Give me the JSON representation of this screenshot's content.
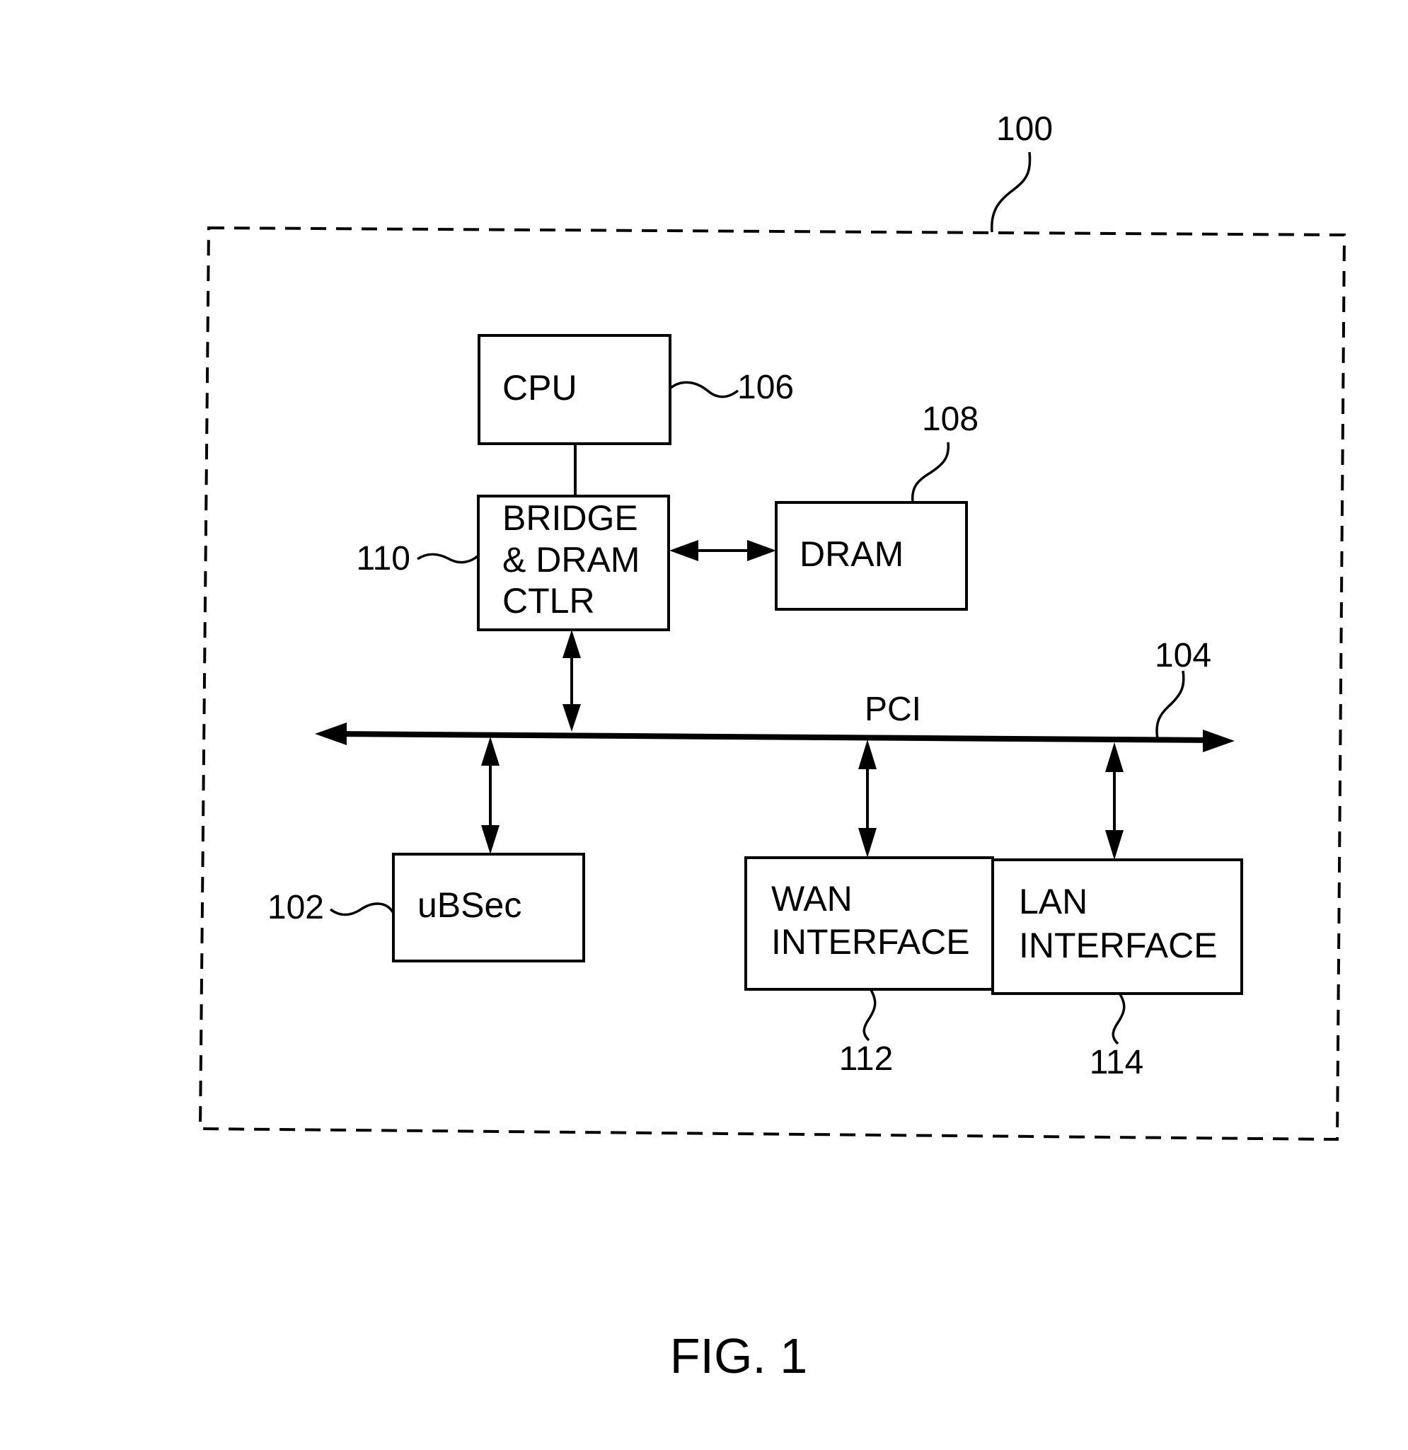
{
  "figure": {
    "caption": "FIG. 1",
    "system_ref": "100"
  },
  "components": {
    "cpu": {
      "label": "CPU",
      "ref": "106"
    },
    "bridge": {
      "lines": [
        "BRIDGE",
        "& DRAM",
        "CTLR"
      ],
      "ref": "110"
    },
    "dram": {
      "label": "DRAM",
      "ref": "108"
    },
    "pci": {
      "label": "PCI",
      "ref": "104"
    },
    "ubsec": {
      "label": "uBSec",
      "ref": "102"
    },
    "wan": {
      "lines": [
        "WAN",
        "INTERFACE"
      ],
      "ref": "112"
    },
    "lan": {
      "lines": [
        "LAN",
        "INTERFACE"
      ],
      "ref": "114"
    }
  }
}
